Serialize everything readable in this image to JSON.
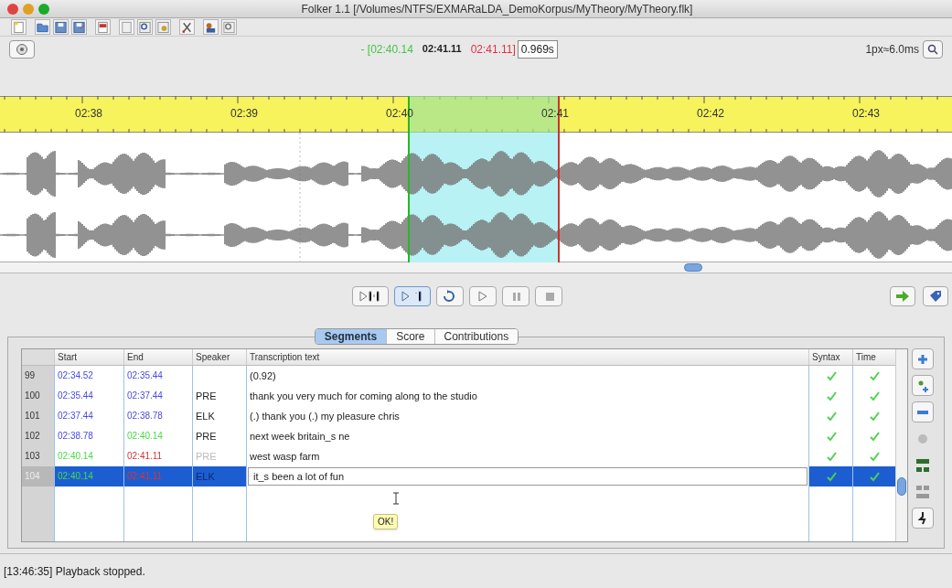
{
  "window": {
    "title": "Folker 1.1 [/Volumes/NTFS/EXMARaLDA_DemoKorpus/MyTheory/MyTheory.flk]"
  },
  "selection": {
    "start": "- [02:40.14",
    "current": "02:41.11",
    "end": "02:41.11]",
    "duration": "0.969s"
  },
  "zoom_label": "1px≈6.0ms",
  "ruler": {
    "labels": [
      "02:38",
      "02:39",
      "02:40",
      "02:41",
      "02:42",
      "02:43"
    ]
  },
  "tabs": [
    {
      "label": "Segments",
      "selected": true
    },
    {
      "label": "Score",
      "selected": false
    },
    {
      "label": "Contributions",
      "selected": false
    }
  ],
  "table": {
    "columns": [
      "Start",
      "End",
      "Speaker",
      "Transcription text",
      "Syntax",
      "Time"
    ],
    "rows": [
      {
        "number": "99",
        "start": {
          "text": "02:34.52",
          "color": "#4a4ae0"
        },
        "end": {
          "text": "02:35.44",
          "color": "#4a4ae0"
        },
        "text": "(0.92)",
        "syntax_ok": true,
        "time_ok": true,
        "selected": false
      },
      {
        "number": "100",
        "start": {
          "text": "02:35.44",
          "color": "#4a4ae0"
        },
        "end": {
          "text": "02:37.44",
          "color": "#4a4ae0"
        },
        "speaker": {
          "text": "PRE",
          "dimmed": false
        },
        "text": "thank you very much for coming along to the studio",
        "syntax_ok": true,
        "time_ok": true,
        "selected": false
      },
      {
        "number": "101",
        "start": {
          "text": "02:37.44",
          "color": "#4a4ae0"
        },
        "end": {
          "text": "02:38.78",
          "color": "#4a4ae0"
        },
        "speaker": {
          "text": "ELK",
          "dimmed": false
        },
        "text": "(.) thank you (.) my pleasure chris",
        "syntax_ok": true,
        "time_ok": true,
        "selected": false
      },
      {
        "number": "102",
        "start": {
          "text": "02:38.78",
          "color": "#4a4ae0"
        },
        "end": {
          "text": "02:40.14",
          "color": "#44dd44"
        },
        "speaker": {
          "text": "PRE",
          "dimmed": false
        },
        "text": "next week britain_s ne",
        "syntax_ok": true,
        "time_ok": true,
        "selected": false
      },
      {
        "number": "103",
        "start": {
          "text": "02:40.14",
          "color": "#44dd44"
        },
        "end": {
          "text": "02:41.11",
          "color": "#dd3333"
        },
        "speaker": {
          "text": "PRE",
          "dimmed": true
        },
        "text": "west wasp farm",
        "syntax_ok": true,
        "time_ok": true,
        "selected": false
      },
      {
        "number": "104",
        "start": {
          "text": "02:40.14",
          "color": "#44dd44"
        },
        "end": {
          "text": "02:41.11",
          "color": "#dd3333"
        },
        "speaker": {
          "text": "ELK",
          "dimmed": false
        },
        "text": "it_s been a lot of fun",
        "syntax_ok": true,
        "time_ok": true,
        "selected": true
      }
    ]
  },
  "tooltip": "OK!",
  "status_bar": "[13:46:35] Playback stopped."
}
